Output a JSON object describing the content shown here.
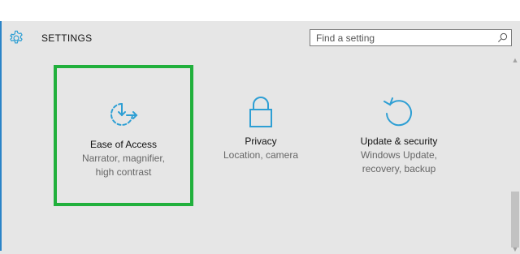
{
  "header": {
    "title": "SETTINGS",
    "icon": "gear-icon"
  },
  "search": {
    "placeholder": "Find a setting",
    "icon": "search-icon"
  },
  "tiles": [
    {
      "title": "Ease of Access",
      "desc_line1": "Narrator, magnifier,",
      "desc_line2": "high contrast",
      "icon": "ease-of-access-icon",
      "highlighted": true
    },
    {
      "title": "Privacy",
      "desc_line1": "Location, camera",
      "desc_line2": "",
      "icon": "lock-icon",
      "highlighted": false
    },
    {
      "title": "Update & security",
      "desc_line1": "Windows Update,",
      "desc_line2": "recovery, backup",
      "icon": "update-icon",
      "highlighted": false
    }
  ],
  "colors": {
    "accent": "#2e9fd4",
    "highlight": "#21b03c",
    "background": "#e6e6e6"
  }
}
